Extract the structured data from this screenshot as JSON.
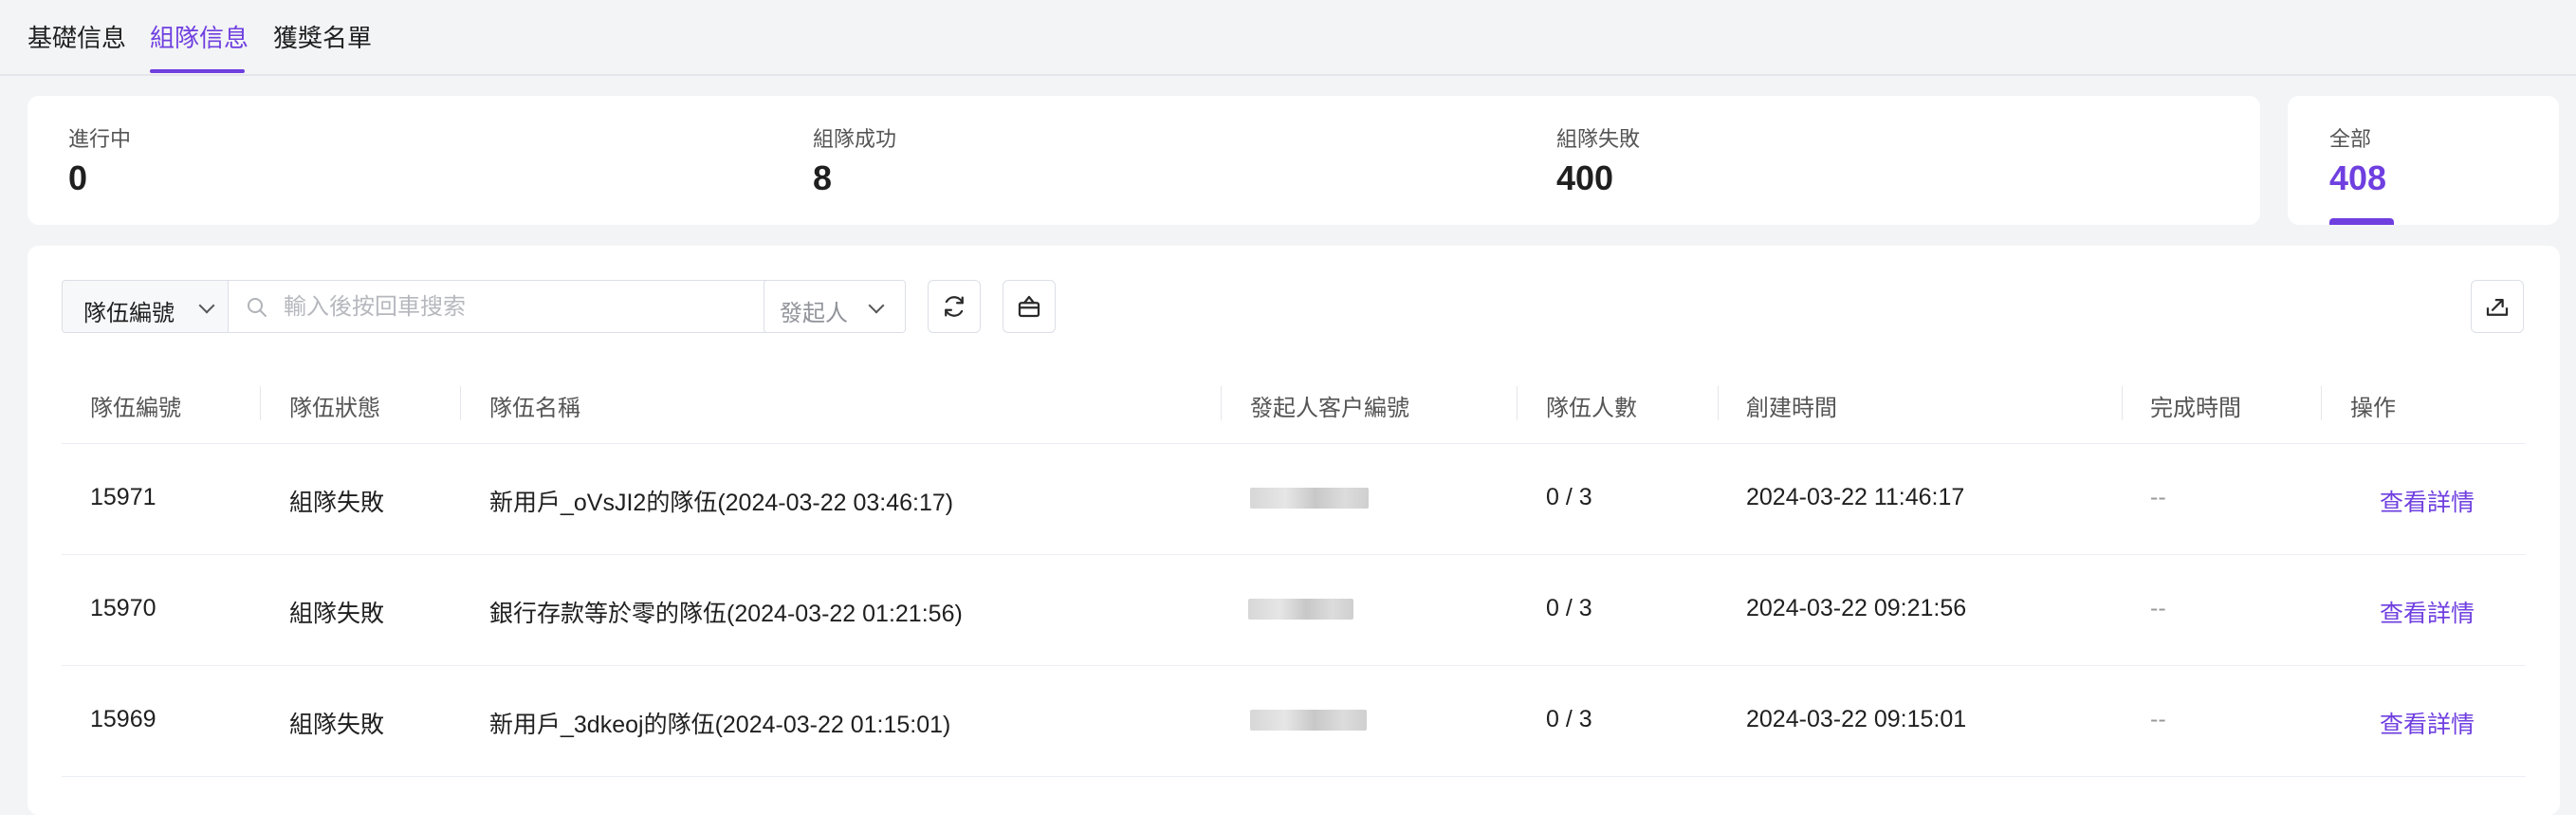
{
  "tabs": [
    {
      "label": "基礎信息"
    },
    {
      "label": "組隊信息"
    },
    {
      "label": "獲獎名單"
    }
  ],
  "active_tab": "組隊信息",
  "accent_color": "#6f3fe0",
  "stats": [
    {
      "label": "進行中",
      "value": "0"
    },
    {
      "label": "組隊成功",
      "value": "8"
    },
    {
      "label": "組隊失敗",
      "value": "400"
    }
  ],
  "total": {
    "label": "全部",
    "value": "408"
  },
  "toolbar": {
    "field_select": "隊伍編號",
    "search_placeholder": "輸入後按回車搜索",
    "initiator_select": "發起人",
    "icons": [
      "refresh-icon",
      "clear-basket-icon",
      "export-icon"
    ]
  },
  "table": {
    "columns": [
      "隊伍編號",
      "隊伍狀態",
      "隊伍名稱",
      "發起人客户編號",
      "隊伍人數",
      "創建時間",
      "完成時間",
      "操作"
    ],
    "rows": [
      {
        "id": "15971",
        "status": "組隊失敗",
        "name": "新用戶_oVsJI2的隊伍(2024-03-22 03:46:17)",
        "members": "0 / 3",
        "created": "2024-03-22 11:46:17",
        "completed": "--",
        "action": "查看詳情"
      },
      {
        "id": "15970",
        "status": "組隊失敗",
        "name": "銀行存款等於零的隊伍(2024-03-22 01:21:56)",
        "members": "0 / 3",
        "created": "2024-03-22 09:21:56",
        "completed": "--",
        "action": "查看詳情"
      },
      {
        "id": "15969",
        "status": "組隊失敗",
        "name": "新用戶_3dkeoj的隊伍(2024-03-22 01:15:01)",
        "members": "0 / 3",
        "created": "2024-03-22 09:15:01",
        "completed": "--",
        "action": "查看詳情"
      }
    ]
  }
}
